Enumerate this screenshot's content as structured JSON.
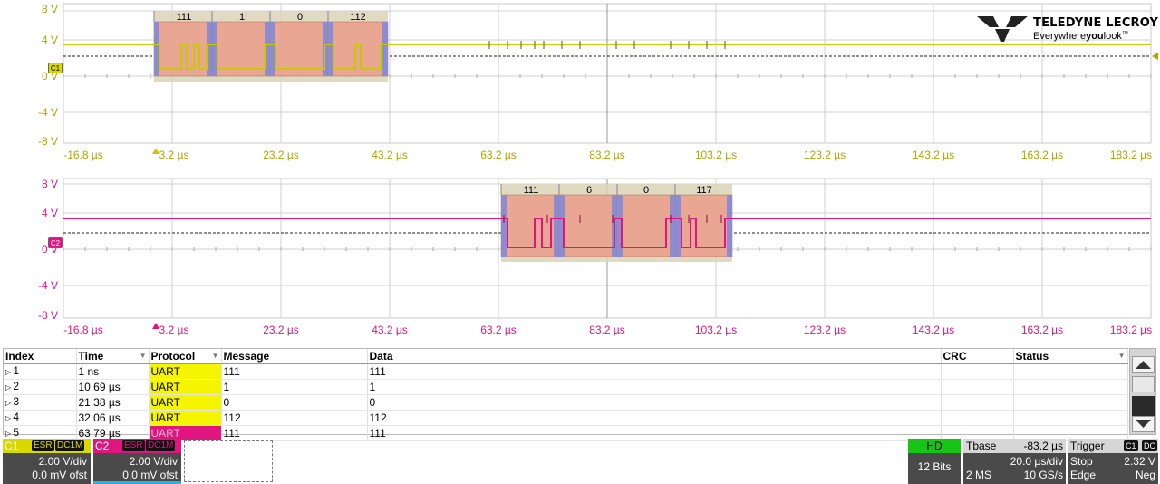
{
  "logo": {
    "brand": "TELEDYNE LECROY",
    "tagline_a": "Everywhere",
    "tagline_b": "you",
    "tagline_c": "look",
    "tagline_tm": "™"
  },
  "colors": {
    "c1": "#d9d900",
    "c1_text": "#a8a800",
    "c2": "#e0157f",
    "decode_fill": "#e9a793",
    "decode_edge": "#8c8cd0",
    "label_bg": "#d9d3b6"
  },
  "panel1": {
    "channel": "C1",
    "y_ticks": [
      "8 V",
      "4 V",
      "0 V",
      "-4 V",
      "-8 V"
    ],
    "x_ticks": [
      "-16.8 µs",
      "3.2 µs",
      "23.2 µs",
      "43.2 µs",
      "63.2 µs",
      "83.2 µs",
      "103.2 µs",
      "123.2 µs",
      "143.2 µs",
      "163.2 µs",
      "183.2 µs"
    ],
    "decode_labels": [
      "111",
      "1",
      "0",
      "112"
    ]
  },
  "panel2": {
    "channel": "C2",
    "y_ticks": [
      "8 V",
      "4 V",
      "0 V",
      "-4 V",
      "-8 V"
    ],
    "x_ticks": [
      "-16.8 µs",
      "3.2 µs",
      "23.2 µs",
      "43.2 µs",
      "63.2 µs",
      "83.2 µs",
      "103.2 µs",
      "123.2 µs",
      "143.2 µs",
      "163.2 µs",
      "183.2 µs"
    ],
    "decode_labels": [
      "111",
      "6",
      "0",
      "117"
    ]
  },
  "table": {
    "headers": {
      "index": "Index",
      "time": "Time",
      "protocol": "Protocol",
      "message": "Message",
      "data": "Data",
      "crc": "CRC",
      "status": "Status"
    },
    "rows": [
      {
        "index": "1",
        "time": "1 ns",
        "protocol": "UART",
        "message": "111",
        "data": "111",
        "crc": "",
        "status": ""
      },
      {
        "index": "2",
        "time": "10.69 µs",
        "protocol": "UART",
        "message": "1",
        "data": "1",
        "crc": "",
        "status": ""
      },
      {
        "index": "3",
        "time": "21.38 µs",
        "protocol": "UART",
        "message": "0",
        "data": "0",
        "crc": "",
        "status": ""
      },
      {
        "index": "4",
        "time": "32.06 µs",
        "protocol": "UART",
        "message": "112",
        "data": "112",
        "crc": "",
        "status": ""
      },
      {
        "index": "5",
        "time": "63.79 µs",
        "protocol": "UART",
        "message": "111",
        "data": "111",
        "crc": "",
        "status": ""
      }
    ]
  },
  "c1box": {
    "name": "C1",
    "esr": "ESR",
    "coupling": "DC1M",
    "vdiv": "2.00 V/div",
    "offset": "0.0 mV ofst"
  },
  "c2box": {
    "name": "C2",
    "esr": "ESR",
    "coupling": "DC1M",
    "vdiv": "2.00 V/div",
    "offset": "0.0 mV ofst"
  },
  "hd": {
    "label": "HD",
    "bits": "12 Bits"
  },
  "tbase": {
    "label": "Tbase",
    "delay": "-83.2 µs",
    "tdiv": "20.0 µs/div",
    "points": "2 MS",
    "rate": "10 GS/s"
  },
  "trigger": {
    "label": "Trigger",
    "src": "C1",
    "coupling": "DC",
    "mode": "Stop",
    "level": "2.32 V",
    "type": "Edge",
    "slope": "Neg"
  }
}
